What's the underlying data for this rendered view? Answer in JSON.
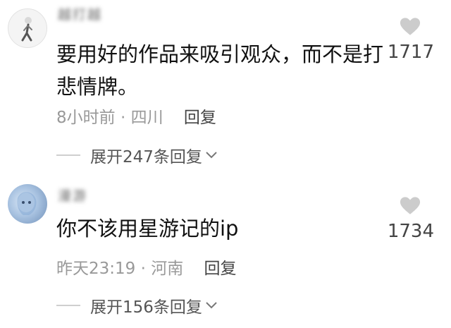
{
  "comments": [
    {
      "username": "越打越",
      "text": "要用好的作品来吸引观众，而不是打悲情牌。",
      "time": "8小时前",
      "location": "四川",
      "reply_label": "回复",
      "likes": "1717",
      "expand_label": "展开247条回复"
    },
    {
      "username": "漫游",
      "text": "你不该用星游记的ip",
      "time": "昨天23:19",
      "location": "河南",
      "reply_label": "回复",
      "likes": "1734",
      "expand_label": "展开156条回复"
    }
  ],
  "icons": {
    "like": "heart-icon",
    "expand": "chevron-down-icon"
  },
  "colors": {
    "heart": "#cccccc",
    "meta": "#999999",
    "text": "#111111"
  }
}
